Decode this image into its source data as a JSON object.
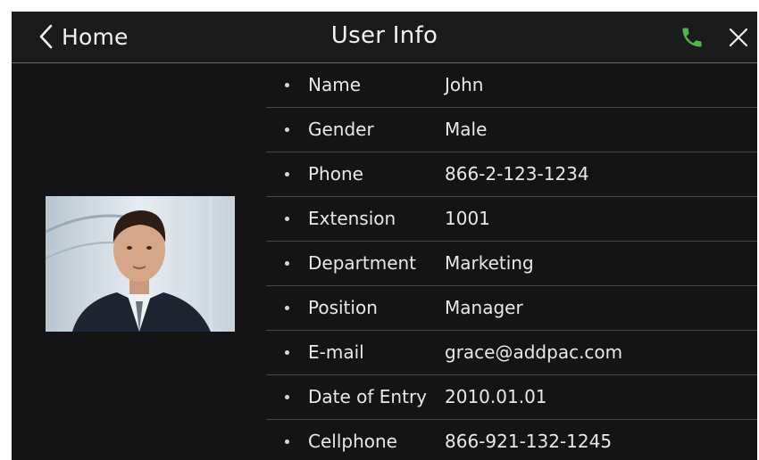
{
  "header": {
    "back_label": "Home",
    "title": "User Info",
    "phone_icon": "phone-icon",
    "close_icon": "close-icon",
    "back_icon": "chevron-left-icon"
  },
  "colors": {
    "background": "#141414",
    "header_bg": "#1b1b1b",
    "text": "#e8e8e8",
    "divider": "#464646",
    "phone_accent": "#4cb849"
  },
  "profile": {
    "photo_alt": "avatar"
  },
  "fields": [
    {
      "label": "Name",
      "value": "John"
    },
    {
      "label": "Gender",
      "value": "Male"
    },
    {
      "label": "Phone",
      "value": "866-2-123-1234"
    },
    {
      "label": "Extension",
      "value": "1001"
    },
    {
      "label": "Department",
      "value": "Marketing"
    },
    {
      "label": "Position",
      "value": "Manager"
    },
    {
      "label": "E-mail",
      "value": "grace@addpac.com"
    },
    {
      "label": "Date of Entry",
      "value": "2010.01.01"
    },
    {
      "label": "Cellphone",
      "value": "866-921-132-1245"
    }
  ]
}
